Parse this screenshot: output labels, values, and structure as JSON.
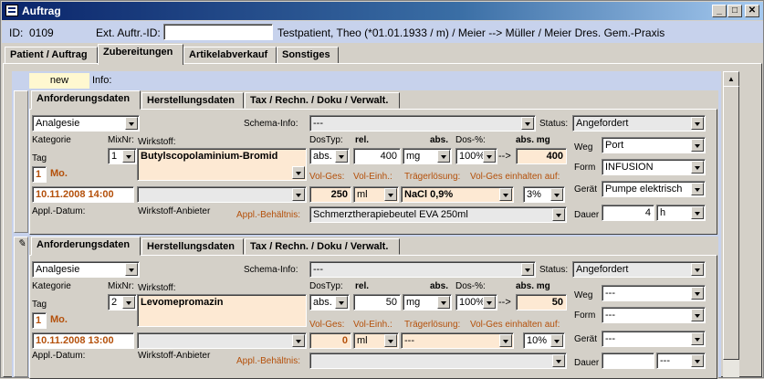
{
  "window": {
    "title": "Auftrag",
    "min": "_",
    "max": "□",
    "close": "✕"
  },
  "header": {
    "id_label": "ID:",
    "id_value": "0109",
    "ext_label": "Ext. Auftr.-ID:",
    "ext_value": "",
    "patient_text": "Testpatient, Theo  (*01.01.1933 / m)  / Meier --> Müller / Meier Dres. Gem.-Praxis"
  },
  "tabs": [
    "Patient / Auftrag",
    "Zubereitungen",
    "Artikelabverkauf",
    "Sonstiges"
  ],
  "new_label": "new",
  "info_label": "Info:",
  "subtabs": [
    "Anforderungsdaten",
    "Herstellungsdaten",
    "Tax / Rechn. / Doku / Verwalt."
  ],
  "labels": {
    "kategorie": "Kategorie",
    "mixnr": "MixNr:",
    "wirkstoff": "Wirkstoff:",
    "tag": "Tag",
    "appl_datum": "Appl.-Datum:",
    "wirkstoff_anbieter": "Wirkstoff-Anbieter",
    "appl_behaeltnis": "Appl.-Behältnis:",
    "schema_info": "Schema-Info:",
    "status": "Status:",
    "dostyp": "DosTyp:",
    "rel": "rel.",
    "abs": "abs.",
    "dos_pct": "Dos-%:",
    "abs_mg": "abs. mg",
    "vol_ges": "Vol-Ges:",
    "vol_einh": "Vol-Einh.:",
    "traegerloesung": "Trägerlösung:",
    "vol_ges_einhalten": "Vol-Ges einhalten auf:",
    "weg": "Weg",
    "form": "Form",
    "geraet": "Gerät",
    "dauer": "Dauer",
    "arrow": "-->"
  },
  "records": [
    {
      "kategorie": "Analgesie",
      "mixnr": "1",
      "wirkstoff": "Butylscopolaminium-Bromid",
      "tag_num": "1",
      "tag_day": "Mo.",
      "appl_datum": "10.11.2008  14:00",
      "anbieter": "",
      "schema_info": "---",
      "status": "Angefordert",
      "dostyp": "abs.",
      "rel_value": "400",
      "unit": "mg",
      "dos_pct": "100%",
      "abs_mg": "400",
      "vol_ges": "250",
      "vol_einh": "ml",
      "traeger": "NaCl 0,9%",
      "vol_pct": "3%",
      "behaeltnis": "Schmerztherapiebeutel EVA 250ml",
      "weg": "Port",
      "form": "INFUSION",
      "geraet": "Pumpe elektrisch",
      "dauer_val": "4",
      "dauer_unit": "h"
    },
    {
      "kategorie": "Analgesie",
      "mixnr": "2",
      "wirkstoff": "Levomepromazin",
      "tag_num": "1",
      "tag_day": "Mo.",
      "appl_datum": "10.11.2008  13:00",
      "anbieter": "",
      "schema_info": "---",
      "status": "Angefordert",
      "dostyp": "abs.",
      "rel_value": "50",
      "unit": "mg",
      "dos_pct": "100%",
      "abs_mg": "50",
      "vol_ges": "0",
      "vol_einh": "ml",
      "traeger": "---",
      "vol_pct": "10%",
      "behaeltnis": "",
      "weg": "---",
      "form": "---",
      "geraet": "---",
      "dauer_val": "",
      "dauer_unit": "---"
    }
  ]
}
